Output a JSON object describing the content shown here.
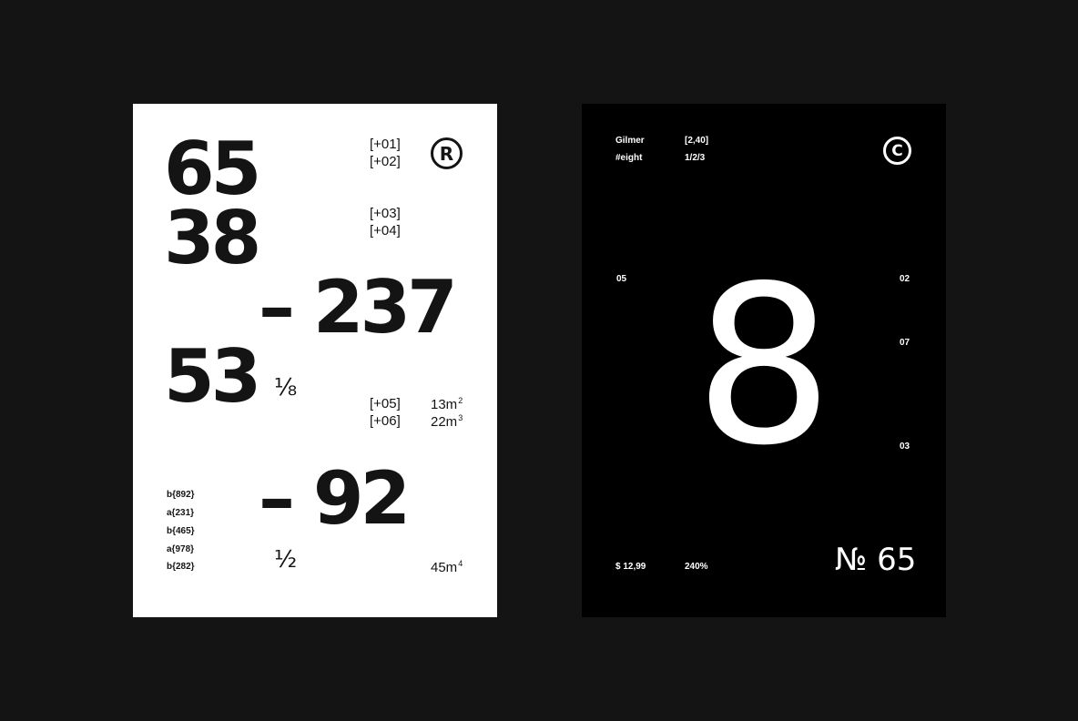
{
  "white_card": {
    "num_65": "65",
    "num_38": "38",
    "num_237": "– 237",
    "num_53": "53",
    "num_92": "– 92",
    "tags": [
      "[+01]",
      "[+02]",
      "[+03]",
      "[+04]",
      "[+05]",
      "[+06]"
    ],
    "registered_symbol": "R",
    "fraction_eighth": "⅛",
    "fraction_half": "½",
    "units": {
      "u1": {
        "base": "13m",
        "exp": "2"
      },
      "u2": {
        "base": "22m",
        "exp": "3"
      },
      "u3": {
        "base": "45m",
        "exp": "4"
      }
    },
    "codes": [
      "b{892}",
      "a{231}",
      "b{465}",
      "a{978}",
      "b{282}"
    ]
  },
  "black_card": {
    "font_name": "Gilmer",
    "hashtag": "#eight",
    "coords": "[2,40]",
    "ratio": "1/2/3",
    "copyright_symbol": "C",
    "hero_digit": "8",
    "left_index": "05",
    "right_indices": [
      "02",
      "07",
      "03"
    ],
    "price": "$ 12,99",
    "percent": "240%",
    "numero": "№ 65"
  },
  "colors": {
    "background": "#141414",
    "white_card": "#ffffff",
    "black_card": "#000000",
    "ink": "#141414"
  }
}
